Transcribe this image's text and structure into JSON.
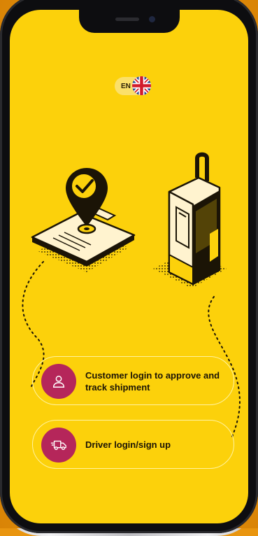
{
  "language": {
    "code": "EN",
    "flag_icon": "uk-flag-icon"
  },
  "options": [
    {
      "label": "Customer login to approve and track shipment",
      "icon": "user-icon"
    },
    {
      "label": "Driver login/sign up",
      "icon": "delivery-truck-icon"
    }
  ],
  "colors": {
    "screen_background": "#fcd10b",
    "icon_circle": "#b5265a",
    "outer_background": "#e9950f"
  },
  "illustrations": [
    "clipboard-with-map-pin-icon",
    "suitcase-icon"
  ]
}
